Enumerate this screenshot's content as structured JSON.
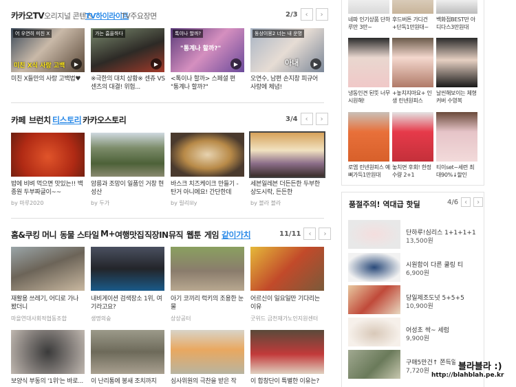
{
  "kakaotv": {
    "tabs": [
      "카카오TV",
      "오리지널 콘텐츠",
      "TV하이라이트",
      "TV주요장면"
    ],
    "page": "2/3",
    "items": [
      {
        "badge": "어 우연히 미친 X",
        "overlay": "미친 X식 사랑 고백",
        "caption": "미친 X들만의 사랑 고백법♥"
      },
      {
        "badge": "가는 흠을하다",
        "overlay": "",
        "caption": "※극한의 대치 상황※ 센츄 VS 센츠의 대결! 위험..."
      },
      {
        "badge": "톡이나 할까?",
        "overlay": "\"통계나 할까?\"",
        "caption": "<톡이나 할까> 스페셜 편 \"통계나 할까?\""
      },
      {
        "badge": "동상이몽2 너는 내 운명",
        "overlay": "아내",
        "caption": "오연수, 남편 손지창 피규어 사랑에 체념!"
      }
    ]
  },
  "cafe": {
    "tabs": [
      "카페",
      "브런치",
      "티스토리",
      "카카오스토리"
    ],
    "page": "3/4",
    "items": [
      {
        "caption": "밥에 비벼 먹으면 맛있는!! 백종원 두부짜글이~~",
        "source": "by 마루2020"
      },
      {
        "caption": "암릉과 조망이 일품인 거창 현성산",
        "source": "by 두가"
      },
      {
        "caption": "바스크 치즈케이크 만들기 - 탄거 아니에요! 간단한데",
        "source": "by 릴리lily"
      },
      {
        "caption": "세븐일레븐 더든든한 두부한상도시락, 든든한",
        "source": "by 블라 블라"
      }
    ]
  },
  "home": {
    "tabs": [
      "홈&쿠킹",
      "머니",
      "동물",
      "스타일",
      "M+",
      "여행맛집",
      "직장IN",
      "뮤직",
      "웹툰",
      "게임",
      "같이가치"
    ],
    "page": "11/11",
    "row1": [
      {
        "caption": "재활용 쓰레기, 어디로 가나 봤더니",
        "source": "마을연대사회적협동조합"
      },
      {
        "caption": "내비게이션 검색장소 1위, 여기라고요?",
        "source": "생명의숲"
      },
      {
        "caption": "아기 코끼리 럭키의 조용한 눈물",
        "source": "상상공터"
      },
      {
        "caption": "어르신이 일요일만 기다리는 이유",
        "source": "굿위드 금천재가노인지원센터"
      }
    ],
    "row2": [
      {
        "caption": "보양식 부동의 '1위'는 바로..."
      },
      {
        "caption": "이 난리통에 봉새 조치까지"
      },
      {
        "caption": "심사위원의 극찬을 받은 작"
      },
      {
        "caption": "이 합창단이 특별한 이유는?"
      }
    ]
  },
  "shop_top": [
    {
      "caption": "네파 인기상품 단하루만 3만~"
    },
    {
      "caption": "후드버튼 가디건 +단독1만원대~"
    },
    {
      "caption": "백화점BEST만 아디다스3만원대"
    }
  ],
  "shop_grid": [
    {
      "caption": "냉동인견 된뜻 너무 시원해!"
    },
    {
      "caption": "+놓치지마요+ 인생 린넨원피스"
    },
    {
      "caption": "날씬해보이는 체형커버 수영복"
    },
    {
      "caption": "로엠 린넨원피스 예뻐가득1만원대"
    },
    {
      "caption": "놓치면 후회! 한정수량 2+1"
    },
    {
      "caption": "티이set~세련 최대90%↓할인"
    }
  ],
  "hot_deals": {
    "title": "품절주의! 역대급 핫딜",
    "page": "4/6",
    "items": [
      {
        "name": "단하루!심리스 1+1+1+1",
        "price": "13,500원"
      },
      {
        "name": "시원함이 다른 쿨링 티",
        "price": "6,900원"
      },
      {
        "name": "당일제조도넛 5+5+5",
        "price": "10,900원"
      },
      {
        "name": "어성초 싹~ 세럼",
        "price": "9,900원"
      },
      {
        "name": "구매5만건↑ 쫀득알곡찰...",
        "price": "7,720원"
      }
    ]
  },
  "watermark": {
    "title": "블라블라 :)",
    "url": "http://blahblah.pe.kr"
  }
}
